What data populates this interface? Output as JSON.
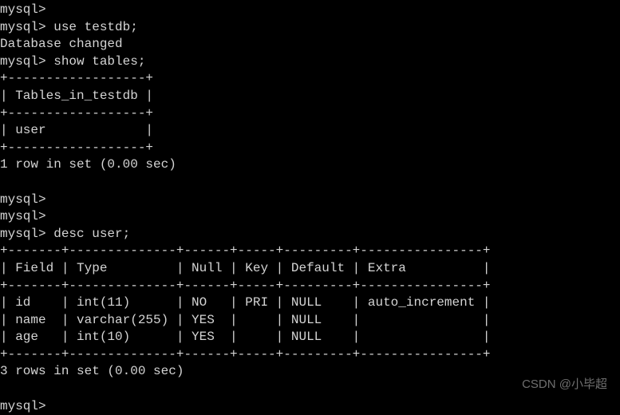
{
  "prompt": "mysql>",
  "commands": {
    "use_db": "use testdb;",
    "db_changed": "Database changed",
    "show_tables": "show tables;",
    "desc_user": "desc user;"
  },
  "tables_result": {
    "border_top": "+------------------+",
    "header": "| Tables_in_testdb |",
    "border_mid": "+------------------+",
    "row": "| user             |",
    "border_bot": "+------------------+",
    "summary": "1 row in set (0.00 sec)"
  },
  "desc_result": {
    "border_top": "+-------+--------------+------+-----+---------+----------------+",
    "header": "| Field | Type         | Null | Key | Default | Extra          |",
    "border_mid": "+-------+--------------+------+-----+---------+----------------+",
    "rows": [
      "| id    | int(11)      | NO   | PRI | NULL    | auto_increment |",
      "| name  | varchar(255) | YES  |     | NULL    |                |",
      "| age   | int(10)      | YES  |     | NULL    |                |"
    ],
    "border_bot": "+-------+--------------+------+-----+---------+----------------+",
    "summary": "3 rows in set (0.00 sec)"
  },
  "watermark": "CSDN @小毕超"
}
